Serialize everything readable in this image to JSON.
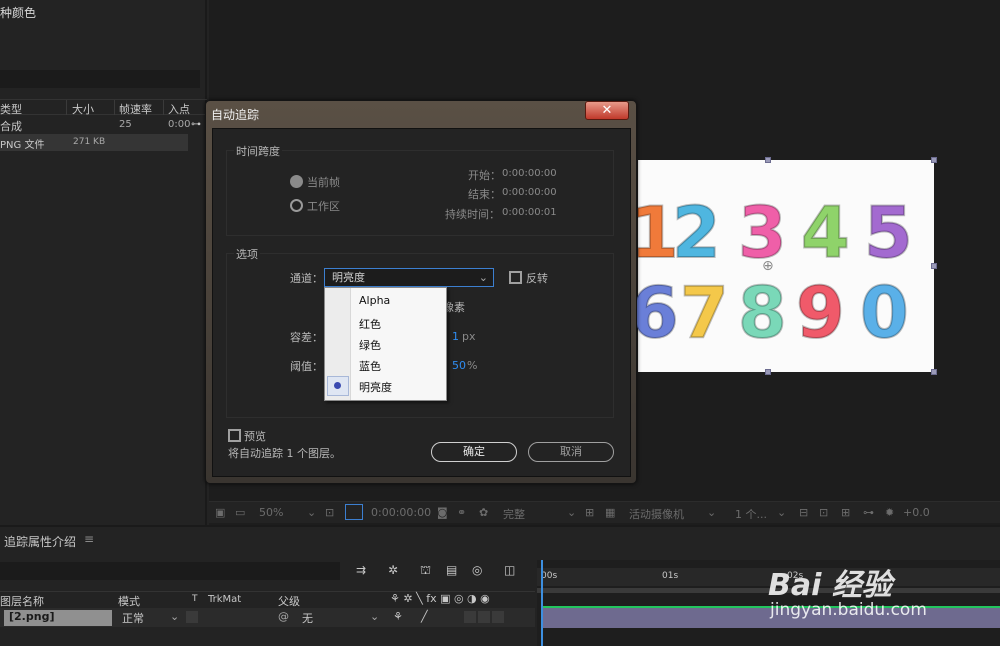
{
  "project": {
    "top_text": "种颜色",
    "columns": [
      "类型",
      "大小",
      "帧速率",
      "入点"
    ],
    "rows": [
      {
        "type": "合成",
        "size": "",
        "fps": "25",
        "in": "0:00"
      },
      {
        "type": "PNG 文件",
        "size": "271 KB",
        "fps": "",
        "in": ""
      }
    ]
  },
  "viewer_bar": {
    "zoom": "50%",
    "timecode": "0:00:00:00",
    "resolution": "完整",
    "camera": "活动摄像机",
    "views": "1 个...",
    "exposure": "+0.0"
  },
  "comp": {
    "digits_row1": [
      "1",
      "2",
      "3",
      "4",
      "5"
    ],
    "digits_row2": [
      "6",
      "7",
      "8",
      "9",
      "0"
    ],
    "colors_row1": [
      "#f07a3a",
      "#4fb6e0",
      "#ef5fa8",
      "#8fd36a",
      "#a36ad0"
    ],
    "colors_row2": [
      "#6a7fd8",
      "#f4c84a",
      "#7ad8b8",
      "#f05a6a",
      "#5ab0e8"
    ]
  },
  "timeline": {
    "tab_label": "追踪属性介绍",
    "ruler_marks": [
      "00s",
      "01s",
      "02s"
    ],
    "columns": {
      "name": "图层名称",
      "mode": "模式",
      "t": "T",
      "trkmat": "TrkMat",
      "parent": "父级"
    },
    "layer": {
      "name": "[2.png]",
      "mode": "正常",
      "parent": "无"
    }
  },
  "dialog": {
    "title": "自动追踪",
    "close": "✕",
    "time_span": {
      "legend": "时间跨度",
      "current_frame": "当前帧",
      "work_area": "工作区",
      "start_label": "开始：",
      "start_value": "0:00:00:00",
      "end_label": "结束：",
      "end_value": "0:00:00:00",
      "duration_label": "持续时间：",
      "duration_value": "0:00:00:01"
    },
    "options": {
      "legend": "选项",
      "channel_label": "通道：",
      "channel_value": "明亮度",
      "invert_label": "反转",
      "pixels_partial": "像素",
      "tolerance_label": "容差：",
      "tolerance_value": "1",
      "tolerance_unit": "px",
      "threshold_label": "阈值：",
      "threshold_value": "50",
      "threshold_unit": "%",
      "dropdown_options": [
        "Alpha",
        "红色",
        "绿色",
        "蓝色",
        "明亮度"
      ],
      "dropdown_selected": "明亮度"
    },
    "preview_label": "预览",
    "status_text": "将自动追踪 1 个图层。",
    "ok_label": "确定",
    "cancel_label": "取消"
  },
  "watermark": {
    "brand": "Bai 经验",
    "url": "jingyan.baidu.com"
  }
}
